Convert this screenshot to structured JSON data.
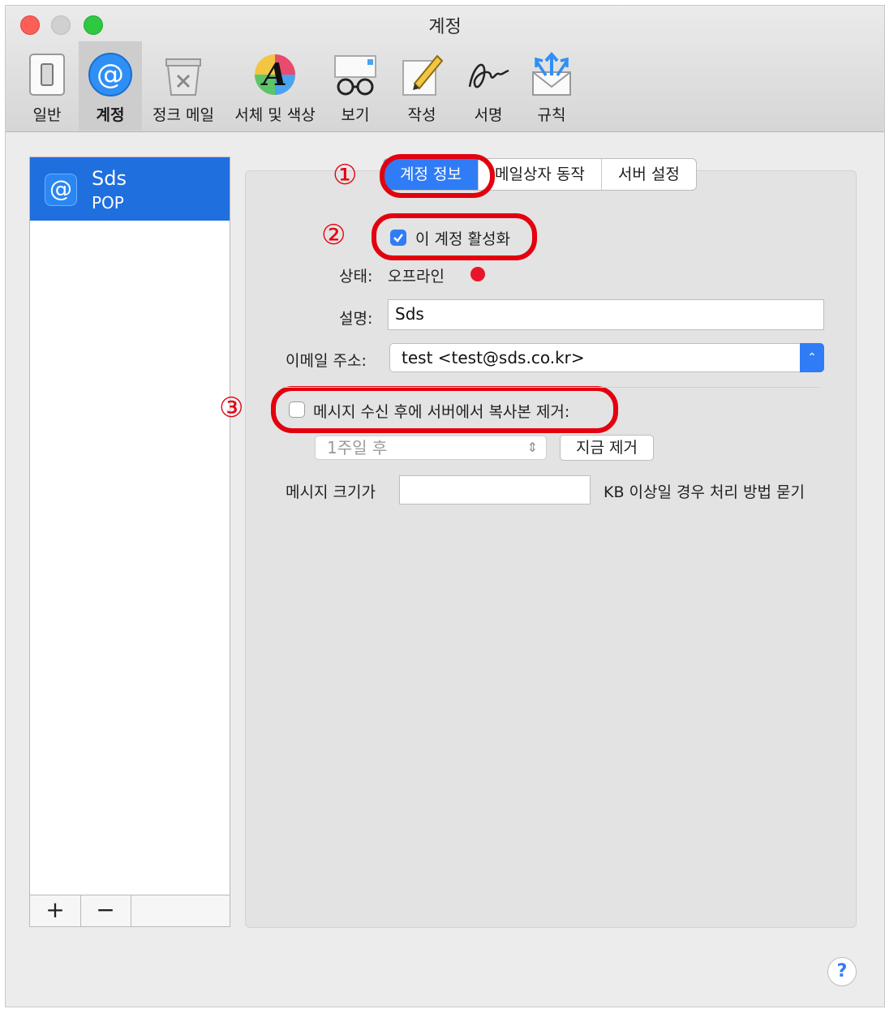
{
  "window": {
    "title": "계정"
  },
  "toolbar": {
    "items": [
      {
        "label": "일반",
        "icon": "switch-icon"
      },
      {
        "label": "계정",
        "icon": "at-sign-icon",
        "selected": true
      },
      {
        "label": "정크 메일",
        "icon": "trash-icon"
      },
      {
        "label": "서체 및 색상",
        "icon": "font-color-icon"
      },
      {
        "label": "보기",
        "icon": "glasses-icon"
      },
      {
        "label": "작성",
        "icon": "pencil-icon"
      },
      {
        "label": "서명",
        "icon": "signature-icon"
      },
      {
        "label": "규칙",
        "icon": "envelope-arrows-icon"
      }
    ]
  },
  "sidebar": {
    "account": {
      "name": "Sds",
      "type": "POP",
      "icon": "at-sign-icon"
    },
    "add_label": "+",
    "remove_label": "−"
  },
  "tabs": [
    {
      "label": "계정 정보",
      "active": true
    },
    {
      "label": "메일상자 동작"
    },
    {
      "label": "서버 설정"
    }
  ],
  "markers": {
    "one": "①",
    "two": "②",
    "three": "③"
  },
  "form": {
    "enable_label": "이 계정 활성화",
    "enable_checked": true,
    "status_label": "상태:",
    "status_value": "오프라인",
    "status_color": "#e8162b",
    "description_label": "설명:",
    "description_value": "Sds",
    "email_label": "이메일 주소:",
    "email_value": "test <test@sds.co.kr>",
    "remove_copy_label": "메시지 수신 후에 서버에서 복사본 제거:",
    "remove_copy_checked": false,
    "remove_after_value": "1주일 후",
    "remove_now_label": "지금 제거",
    "size_label": "메시지 크기가",
    "size_value": "",
    "size_suffix": "KB 이상일 경우 처리 방법 묻기"
  },
  "help_label": "?",
  "colors": {
    "accent": "#2f7cf6",
    "highlight_ring": "#e3000f",
    "sidebar_selected": "#1f6fde"
  }
}
